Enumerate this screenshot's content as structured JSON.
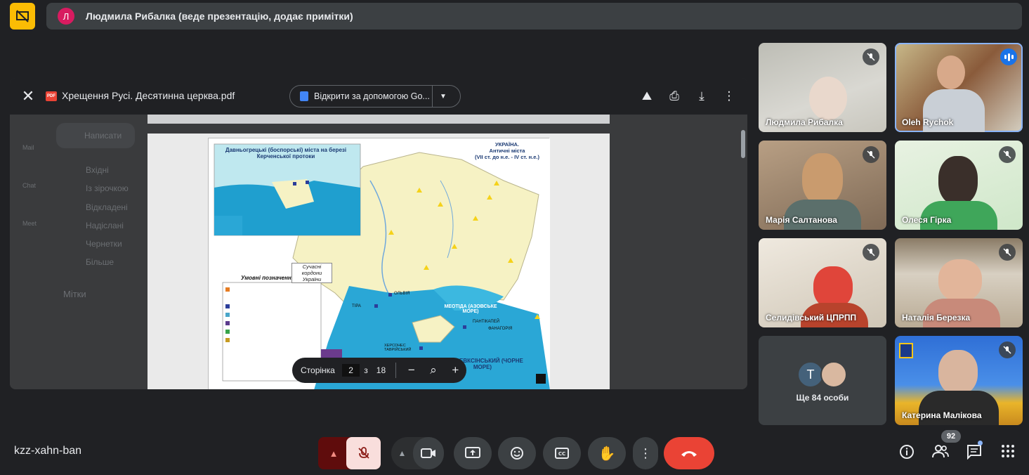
{
  "presenter": {
    "avatar_letter": "Л",
    "text": "Людмила Рибалка (веде презентацію, додає примітки)"
  },
  "viewer": {
    "file_name": "Хрещення Русі. Десятинна церква.pdf",
    "open_with_label": "Відкрити за допомогою Go...",
    "pdf_badge": "PDF",
    "page_label": "Сторінка",
    "current_page": "2",
    "of_label": "з",
    "total_pages": "18"
  },
  "map": {
    "inset_title": "Давньогрецькі (боспорські) міста на березі Керченської протоки",
    "title_line1": "УКРАЇНА.",
    "title_line2": "Античні міста",
    "title_line3": "(VII ст. до н.е. - IV ст. н.е.)",
    "legend_title": "Умовні позначення",
    "borders_label": "Сучасні кордони України",
    "sea_label": "МЕОТІДА (АЗОВСЬКЕ МОРЕ)",
    "black_sea_label": "ПОНТ ЕВКСІНСЬКИЙ (ЧОРНЕ МОРЕ)",
    "city_olvia": "ОЛЬВІЯ",
    "city_tira": "ТІРА",
    "city_chersones": "ХЕРСОНЕС ТАВРІЙСЬКИЙ",
    "city_pantikapei": "ПАНТІКАПЕЙ",
    "city_fanagoria": "ФАНАГОРІЯ"
  },
  "ghost_gmail": {
    "compose": "Написати",
    "inbox": "Вхідні",
    "starred": "Із зірочкою",
    "snoozed": "Відкладені",
    "sent": "Надіслані",
    "drafts": "Чернетки",
    "more": "Більше",
    "labels": "Мітки",
    "mail": "Mail",
    "chat": "Chat",
    "meet": "Meet"
  },
  "participants": [
    {
      "name": "Людмила Рибалка",
      "muted": true
    },
    {
      "name": "Oleh Rychok",
      "muted": false,
      "speaking": true
    },
    {
      "name": "Марія Салтанова",
      "muted": true
    },
    {
      "name": "Олеся Гірка",
      "muted": true
    },
    {
      "name": "Селидівський ЦПРПП",
      "muted": true
    },
    {
      "name": "Наталія Березка",
      "muted": true
    },
    {
      "name": "Катерина Малікова",
      "muted": true
    }
  ],
  "more_tile": {
    "avatar_letter": "T",
    "text": "Ще 84 особи"
  },
  "bottom": {
    "meeting_code": "kzz-xahn-ban",
    "participant_count": "92"
  },
  "colors": {
    "accent": "#8ab4f8",
    "end_call": "#ea4335",
    "muted_bg": "#f9dedc",
    "presenter_avatar": "#d81b60",
    "badge": "#fbbc04"
  }
}
